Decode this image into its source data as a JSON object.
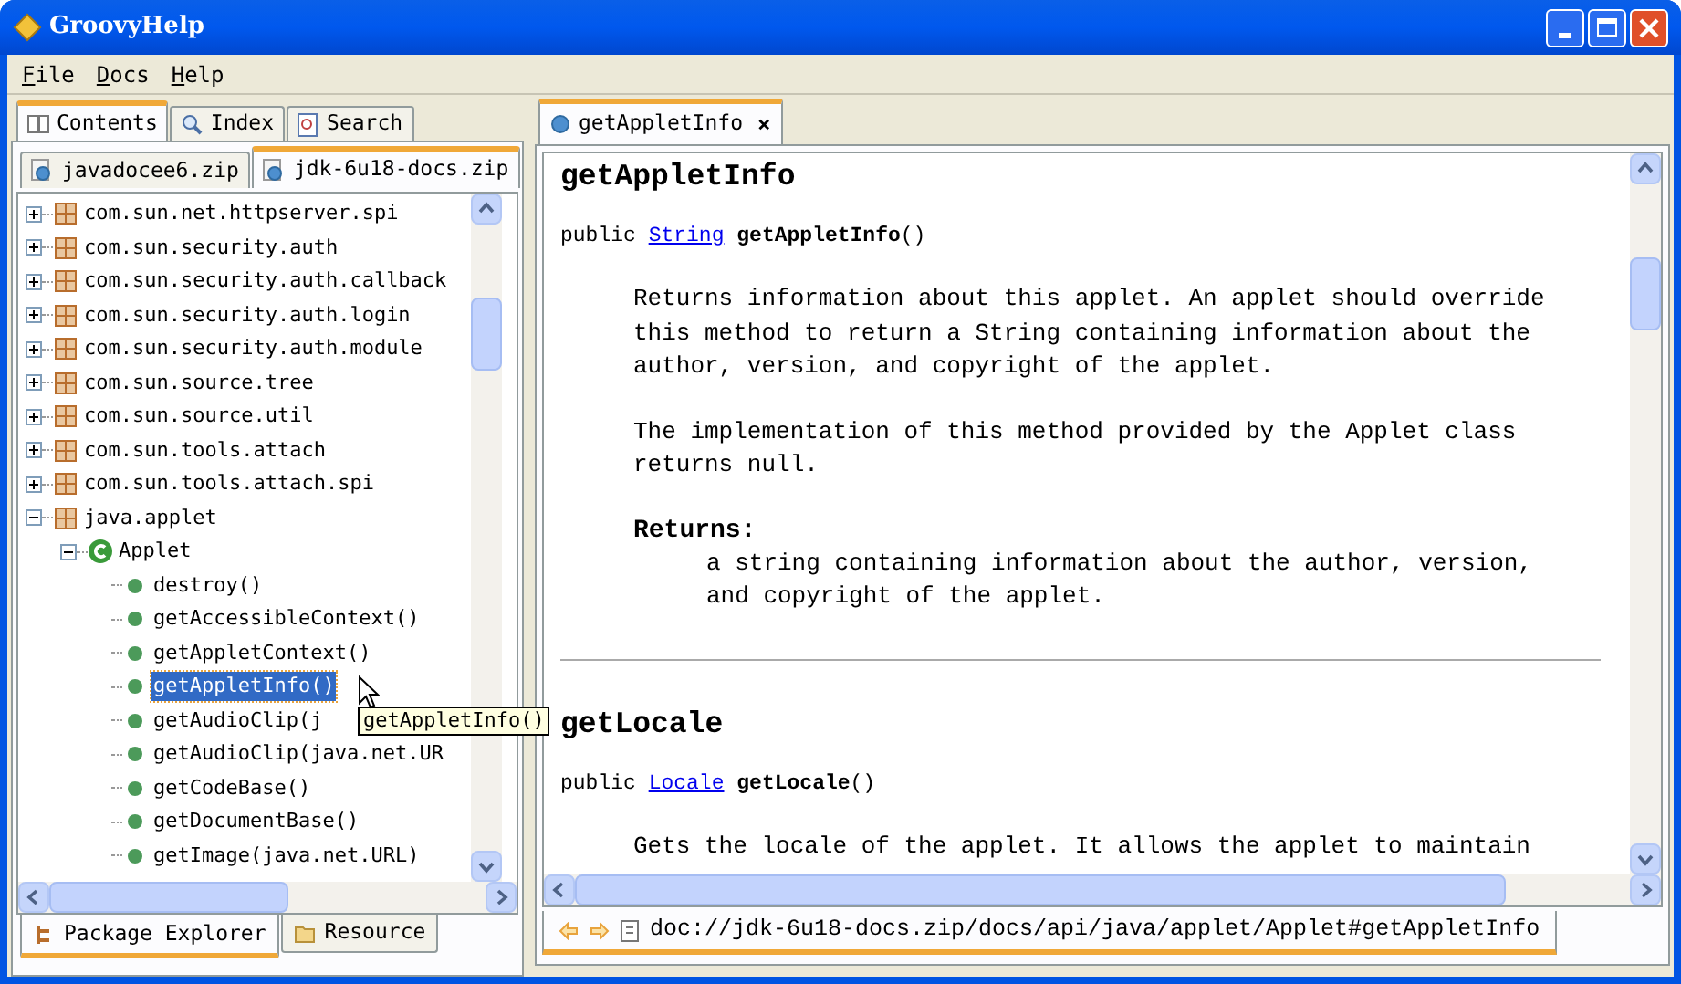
{
  "window": {
    "title": "GroovyHelp"
  },
  "menu": [
    {
      "label": "File"
    },
    {
      "label": "Docs"
    },
    {
      "label": "Help"
    }
  ],
  "nav_tabs": [
    {
      "label": "Contents",
      "kind": "book",
      "selected": true
    },
    {
      "label": "Index",
      "kind": "search",
      "selected": false
    },
    {
      "label": "Search",
      "kind": "find",
      "selected": false
    }
  ],
  "doc_tabs": [
    {
      "label": "javadocee6.zip",
      "selected": false
    },
    {
      "label": "jdk-6u18-docs.zip",
      "selected": true
    }
  ],
  "tree": [
    {
      "label": "com.sun.net.httpserver.spi",
      "kind": "package",
      "expanded": false,
      "selected": false
    },
    {
      "label": "com.sun.security.auth",
      "kind": "package",
      "expanded": false,
      "selected": false
    },
    {
      "label": "com.sun.security.auth.callback",
      "kind": "package",
      "expanded": false,
      "selected": false
    },
    {
      "label": "com.sun.security.auth.login",
      "kind": "package",
      "expanded": false,
      "selected": false
    },
    {
      "label": "com.sun.security.auth.module",
      "kind": "package",
      "expanded": false,
      "selected": false
    },
    {
      "label": "com.sun.source.tree",
      "kind": "package",
      "expanded": false,
      "selected": false
    },
    {
      "label": "com.sun.source.util",
      "kind": "package",
      "expanded": false,
      "selected": false
    },
    {
      "label": "com.sun.tools.attach",
      "kind": "package",
      "expanded": false,
      "selected": false
    },
    {
      "label": "com.sun.tools.attach.spi",
      "kind": "package",
      "expanded": false,
      "selected": false
    },
    {
      "label": "java.applet",
      "kind": "package",
      "expanded": true,
      "selected": false,
      "children": [
        {
          "label": "Applet",
          "kind": "class",
          "expanded": true,
          "selected": false,
          "children": [
            {
              "label": "destroy()",
              "kind": "method",
              "selected": false
            },
            {
              "label": "getAccessibleContext()",
              "kind": "method",
              "selected": false
            },
            {
              "label": "getAppletContext()",
              "kind": "method",
              "selected": false
            },
            {
              "label": "getAppletInfo()",
              "kind": "method",
              "selected": true
            },
            {
              "label": "getAudioClip(j",
              "kind": "method",
              "selected": false
            },
            {
              "label": "getAudioClip(java.net.UR",
              "kind": "method",
              "selected": false
            },
            {
              "label": "getCodeBase()",
              "kind": "method",
              "selected": false
            },
            {
              "label": "getDocumentBase()",
              "kind": "method",
              "selected": false
            },
            {
              "label": "getImage(java.net.URL)",
              "kind": "method",
              "selected": false
            }
          ]
        }
      ]
    }
  ],
  "tooltip": "getAppletInfo()",
  "bottom_tabs": [
    {
      "label": "Package Explorer",
      "selected": true
    },
    {
      "label": "Resource",
      "selected": false
    }
  ],
  "editor_tab": {
    "label": "getAppletInfo",
    "close": "×"
  },
  "sections": [
    {
      "title": "getAppletInfo",
      "signature": {
        "prefix": "public",
        "type": "String",
        "name": "getAppletInfo",
        "suffix": "()"
      },
      "paragraphs": [
        "Returns information about this applet. An applet should override this method to return a String containing information about the author, version, and copyright of the applet.",
        "The implementation of this method provided by the Applet class returns null."
      ],
      "returns": {
        "label": "Returns:",
        "text": "a string containing information about the author, version, and copyright of the applet."
      }
    },
    {
      "title": "getLocale",
      "signature": {
        "prefix": "public",
        "type": "Locale",
        "name": "getLocale",
        "suffix": "()"
      },
      "paragraphs": [
        "Gets the locale of the applet. It allows the applet to maintain"
      ]
    }
  ],
  "status": {
    "url": "doc://jdk-6u18-docs.zip/docs/api/java/applet/Applet#getAppletInfo"
  }
}
